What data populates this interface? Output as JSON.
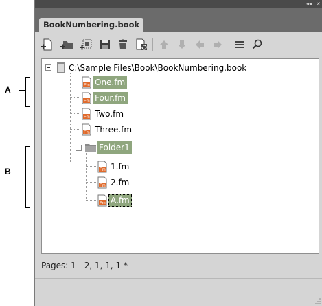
{
  "annotations": {
    "a_label": "A",
    "b_label": "B"
  },
  "panel": {
    "titlebar": {
      "collapse_glyph": "◂◂",
      "close_glyph": "×"
    },
    "tab_label": "BookNumbering.book",
    "toolbar": [
      "add-file-icon",
      "add-folder-icon",
      "add-group-icon",
      "save-icon",
      "delete-icon",
      "update-book-icon",
      "move-up-icon",
      "move-down-icon",
      "move-left-icon",
      "move-right-icon",
      "panel-menu-icon",
      "search-icon"
    ],
    "tree": {
      "root": "C:\\Sample Files\\Book\\BookNumbering.book",
      "items": [
        {
          "label": "One.fm",
          "selected": true
        },
        {
          "label": "Four.fm",
          "selected": true
        },
        {
          "label": "Two.fm",
          "selected": false
        },
        {
          "label": "Three.fm",
          "selected": false
        }
      ],
      "folder": {
        "label": "Folder1",
        "selected": true,
        "children": [
          {
            "label": "1.fm",
            "selected": false
          },
          {
            "label": "2.fm",
            "selected": false
          },
          {
            "label": "A.fm",
            "selected": true,
            "focused": true
          }
        ]
      }
    },
    "status": "Pages: 1 - 2, 1, 1, 1 *"
  },
  "colors": {
    "selection": "#8fa67e",
    "file_icon_accent": "#e06a2b",
    "folder_icon": "#8a8a8a",
    "titlebar": "#4a4a4a",
    "tabstrip": "#6b6b6b"
  }
}
